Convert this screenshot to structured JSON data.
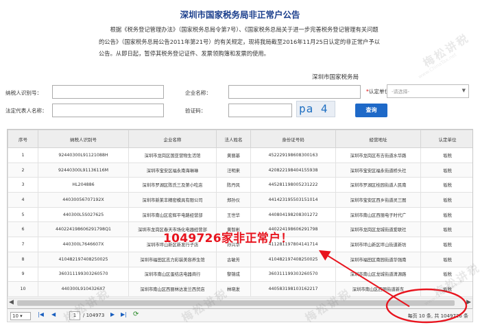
{
  "title": "深圳市国家税务局非正常户公告",
  "notice_text": "根据《税务登记管理办法》（国家税务总局令第7号）、《国家税务总局关于进一步完善税务登记管理有关问题的公告》（国家税务总局公告2011年第21号）的有关规定，现将我局截至2016年11月25日认定的非正常户予以公告。从即日起，暂停其税务登记证件、发票领购簿和发票的使用。",
  "issuer": "深圳市国家税务局",
  "form": {
    "taxpayer_id_label": "纳税人识别号：",
    "company_name_label": "企业名称：",
    "identify_unit_label": "认定单位",
    "identify_unit_required": "*",
    "identify_unit_placeholder": "-请选择-",
    "legal_rep_label": "法定代表人名称：",
    "captcha_label": "验证码：",
    "captcha_text": "pa 4 n",
    "query_button": "查询"
  },
  "table": {
    "columns": [
      "序号",
      "纳税人识别号",
      "企业名称",
      "法人姓名",
      "身份证号码",
      "经营地址",
      "认定单位"
    ],
    "rows": [
      [
        "1",
        "92440300L91121088H",
        "深圳市龙岗区国亚营物生活馆",
        "黄丽基",
        "452229198608300163",
        "深圳市龙岗区布吉街道水华路",
        "坂税"
      ],
      [
        "2",
        "92440300L91136116M",
        "深圳市宝安区福永南海琳琳",
        "汪明来",
        "420822198404155938",
        "深圳市宝安区福永街道桥头社",
        "坂税"
      ],
      [
        "3",
        "HL204886",
        "深圳市罗湖区陈氏三及第小吃店",
        "陈丹风",
        "445281198005231222",
        "深圳市罗湖区桂园街道人民南",
        "坂税"
      ],
      [
        "4",
        "44030056707192X",
        "深圳市新莱丰精密模具有限公司",
        "郑孙仪",
        "441423195503151014",
        "深圳市宝安区西乡街道灵三图",
        "坂税"
      ],
      [
        "5",
        "440300L5S027625",
        "深圳市南山区宏辉平电路经营部",
        "王世华",
        "440804198208301272",
        "深圳市南山区西丽电子时代广",
        "坂税"
      ],
      [
        "6",
        "440224198606291798Q1",
        "深圳市龙岗区春天市场化电器经营部",
        "黄智彬",
        "440224198606291798",
        "深圳市龙岗区龙城街道爱联社",
        "坂税"
      ],
      [
        "7",
        "440300L7646607X",
        "深圳市坪山新区新发行子店",
        "孙兴华",
        "411281197804141714",
        "深圳市坪山新区坪山街道新坊",
        "坂税"
      ],
      [
        "8",
        "410482197408250025",
        "深圳市福田区志力彩装美容养生馆",
        "古敏芳",
        "410482197408250025",
        "深圳市福田区南园街道华强南",
        "坂税"
      ],
      [
        "9",
        "360311199303260570",
        "深圳市南山区蛋结店电器商行",
        "黎锦成",
        "360311199303260570",
        "深圳市南山区龙城街道清源路",
        "坂税"
      ],
      [
        "10",
        "440300L9104326X7",
        "深圳市南山区西丽林达发兰西贸店",
        "林晓发",
        "440583198103162217",
        "深圳市南山区西丽街道新东",
        "坂税"
      ]
    ]
  },
  "big_notice": "1049726家非正常户！",
  "pager": {
    "page_size": "10",
    "current_page": "1",
    "total_pages": "/ 104973",
    "info": "每页 10 条, 共 1049726 条"
  },
  "watermark": {
    "main": "梅松讲税",
    "sub": "www.ChinaTax.net"
  },
  "colors": {
    "title": "#1a3e8c",
    "button": "#1e69c8",
    "annotation": "#e8141e"
  }
}
